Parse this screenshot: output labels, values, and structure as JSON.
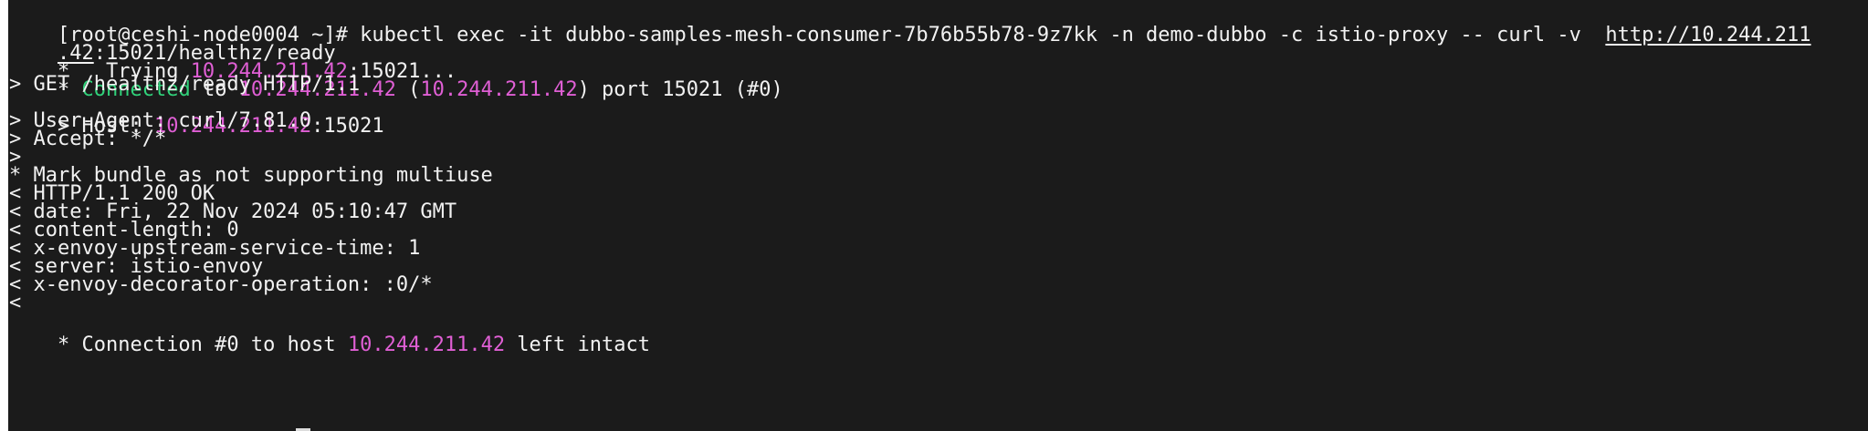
{
  "terminal": {
    "lines": [
      {
        "prompt": "[root@ceshi-node0004 ~]# ",
        "command": "kubectl exec -it dubbo-samples-mesh-consumer-7b76b55b78-9z7kk -n demo-dubbo -c istio-proxy -- curl -v  ",
        "url": "http://10.244.211"
      },
      {
        "url_cont": ".42",
        "rest": ":15021/healthz/ready"
      },
      {
        "pre": "*   Trying ",
        "ip": "10.244.211.42",
        "post": ":15021..."
      },
      {
        "pre": "* ",
        "connected": "Connected",
        "to": " to ",
        "ip": "10.244.211.42",
        "paren_open": " (",
        "ip2": "10.244.211.42",
        "post": ") port 15021 (#0)"
      },
      {
        "text": "> GET /healthz/ready HTTP/1.1"
      },
      {
        "pre": "> Host: ",
        "ip": "10.244.211.42",
        "post": ":15021"
      },
      {
        "text": "> User-Agent: curl/7.81.0"
      },
      {
        "text": "> Accept: */*"
      },
      {
        "text": ">"
      },
      {
        "text": "* Mark bundle as not supporting multiuse"
      },
      {
        "text": "< HTTP/1.1 200 OK"
      },
      {
        "text": "< date: Fri, 22 Nov 2024 05:10:47 GMT"
      },
      {
        "text": "< content-length: 0"
      },
      {
        "text": "< x-envoy-upstream-service-time: 1"
      },
      {
        "text": "< server: istio-envoy"
      },
      {
        "text": "< x-envoy-decorator-operation: :0/*"
      },
      {
        "text": "<"
      },
      {
        "pre": "* Connection #0 to host ",
        "ip": "10.244.211.42",
        "post": " left intact"
      }
    ]
  },
  "colors": {
    "background": "#1b1b1b",
    "text": "#f2f2f2",
    "ip": "#e05fd5",
    "connected": "#30d27a"
  }
}
